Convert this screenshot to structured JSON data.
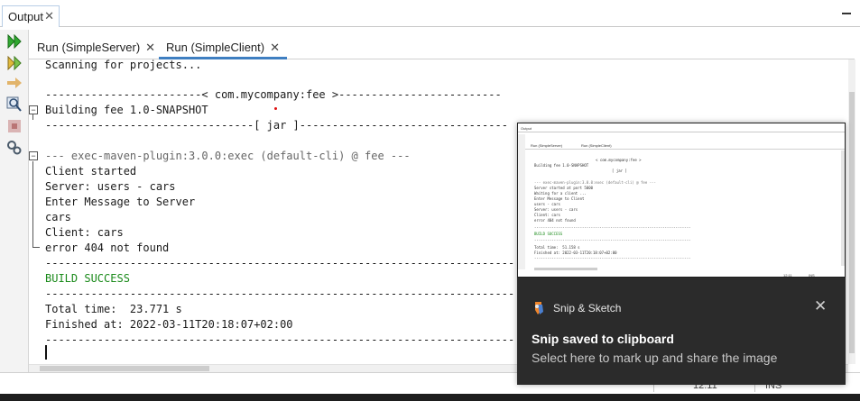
{
  "panel": {
    "tab_label": "Output",
    "tab_close": "✕"
  },
  "run_tabs": [
    {
      "label": "Run (SimpleServer)",
      "close": "✕",
      "active": false
    },
    {
      "label": "Run (SimpleClient)",
      "close": "✕",
      "active": true
    }
  ],
  "toolbar_icons": [
    "rerun-icon",
    "rerun-with-options-icon",
    "step-icon",
    "find-icon",
    "stop-icon",
    "settings-icon"
  ],
  "console": {
    "lines": [
      "Scanning for projects...",
      "",
      "------------------------< com.mycompany:fee >-------------------------",
      "Building fee 1.0-SNAPSHOT",
      "--------------------------------[ jar ]--------------------------------",
      "",
      "--- exec-maven-plugin:3.0.0:exec (default-cli) @ fee ---",
      "Client started",
      "Server: users - cars",
      "Enter Message to Server",
      "cars",
      "Client: cars",
      "error 404 not found",
      "------------------------------------------------------------------------",
      "BUILD SUCCESS",
      "------------------------------------------------------------------------",
      "Total time:  23.771 s",
      "Finished at: 2022-03-11T20:18:07+02:00",
      "------------------------------------------------------------------------"
    ]
  },
  "status_bar": {
    "position": "12:11",
    "mode": "INS"
  },
  "notification": {
    "app_name": "Snip & Sketch",
    "close": "✕",
    "title": "Snip saved to clipboard",
    "body": "Select here to mark up and share the image",
    "preview": {
      "tab_label": "Output",
      "run_tabs": [
        "Run (SimpleServer)",
        "Run (SimpleClient)"
      ],
      "lines": [
        "< com.mycompany:fee >",
        "Building fee 1.0-SNAPSHOT",
        "[ jar ]",
        "--- exec-maven-plugin:3.0.0:exec (default-cli) @ fee ---",
        "Server started at port 5000",
        "Waiting for a client ...",
        "Enter Message to Client",
        "users - cars",
        "Server: users - cars",
        "Client: cars",
        "error 404 not found",
        "------------------------------------------------------------------------",
        "BUILD SUCCESS",
        "------------------------------------------------------------------------",
        "Total time:  51.158 s",
        "Finished at: 2022-03-11T20:18:07+02:00",
        "------------------------------------------------------------------------"
      ],
      "status_position": "12:11",
      "status_mode": "INS"
    }
  },
  "colors": {
    "accent": "#3f7fc1",
    "success": "#1a8a1a",
    "notification_bg": "#2b2b2b",
    "error_mark": "#e01010"
  }
}
